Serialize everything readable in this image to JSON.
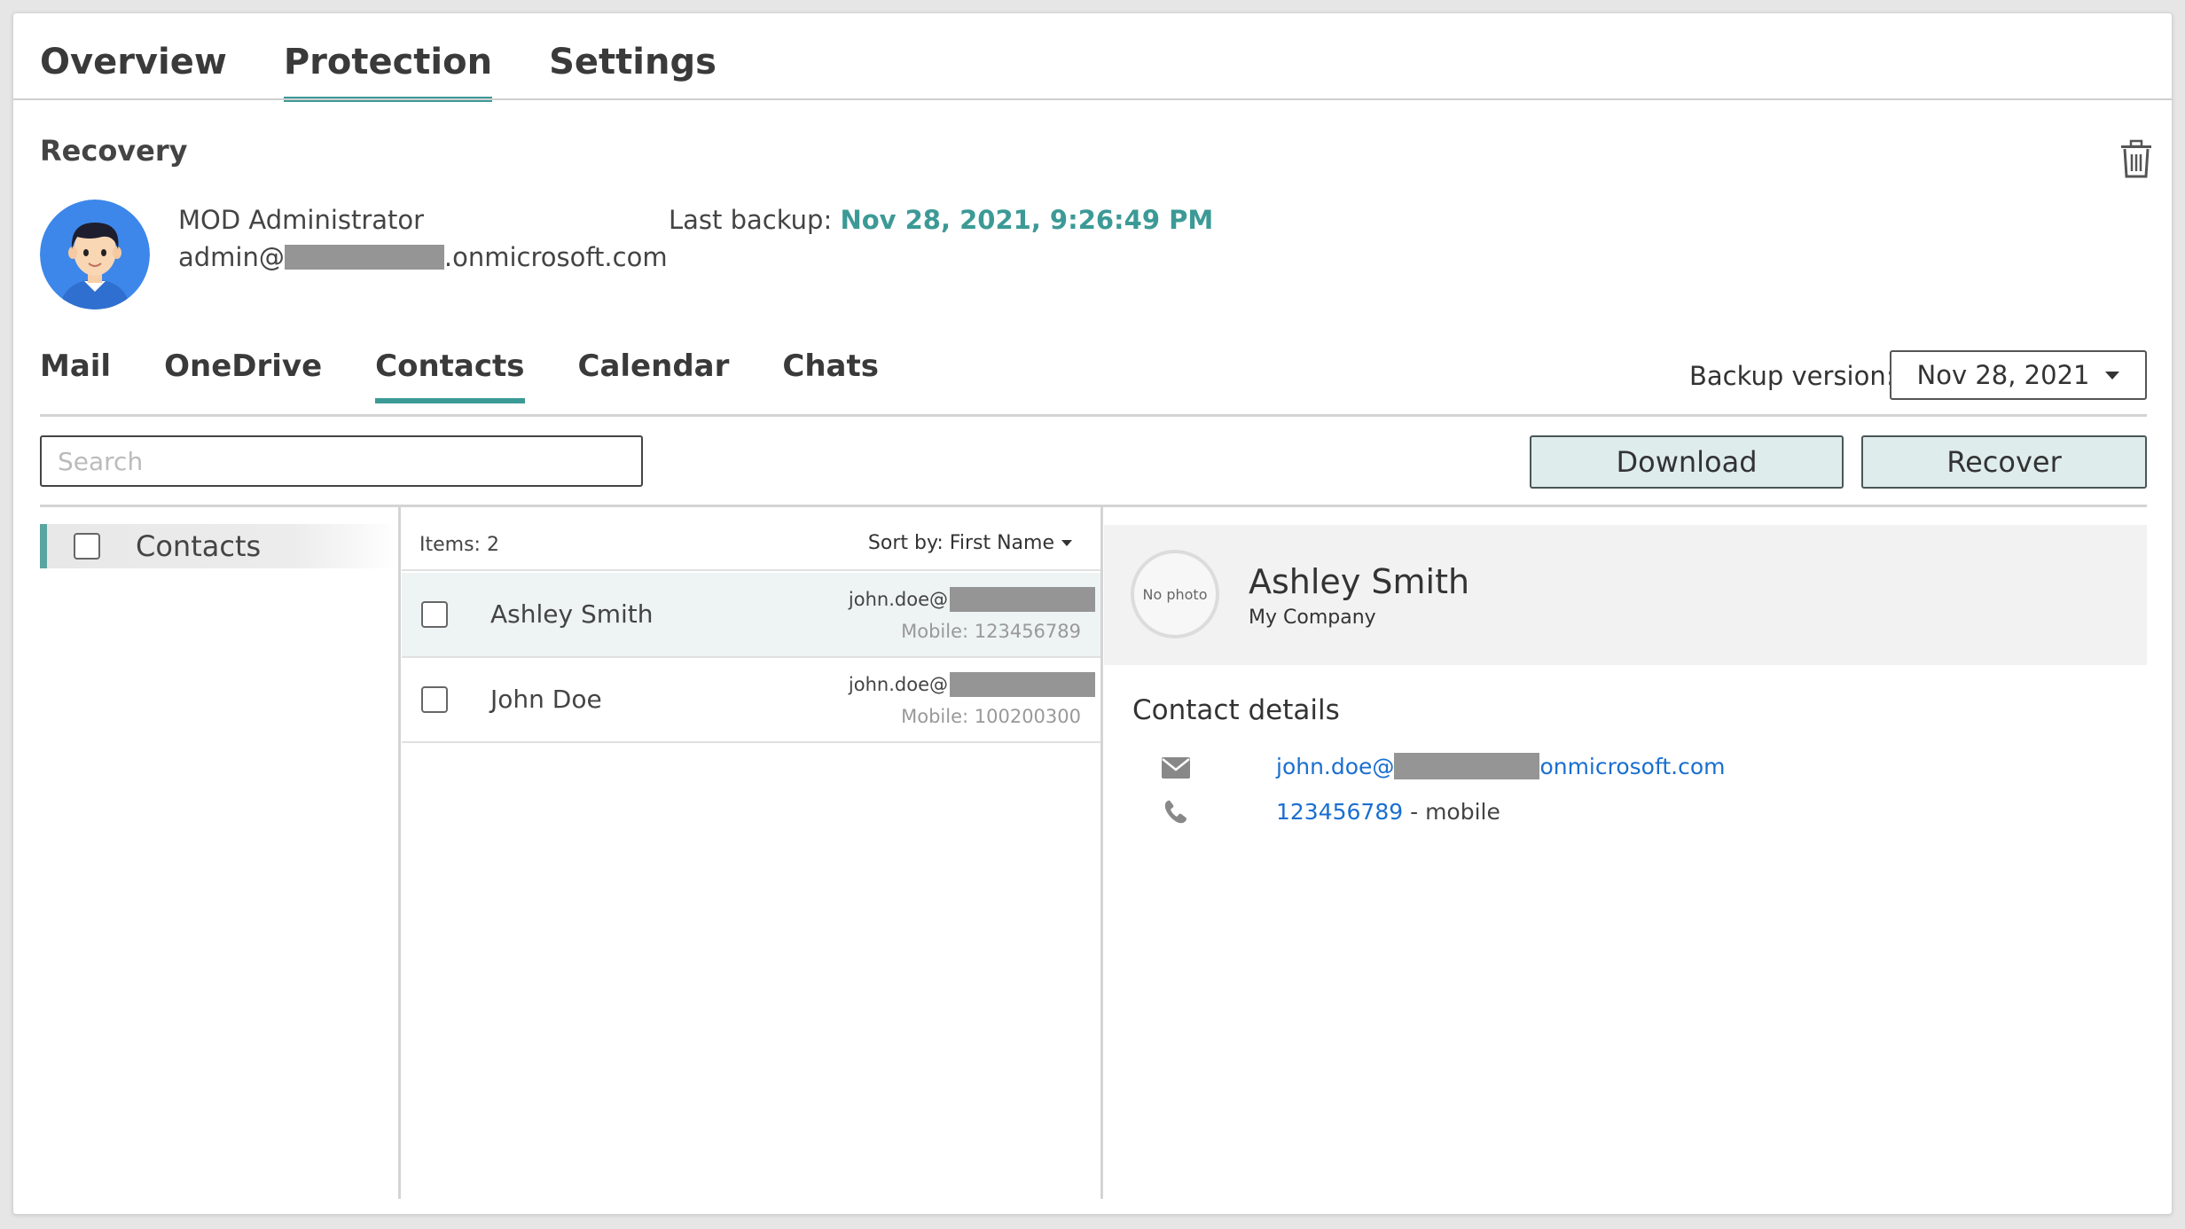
{
  "tabs": [
    "Overview",
    "Protection",
    "Settings"
  ],
  "section_title": "Recovery",
  "user": {
    "name": "MOD Administrator",
    "email_prefix": "admin@",
    "email_suffix": ".onmicrosoft.com"
  },
  "last_backup": {
    "label": "Last backup:",
    "value": "Nov 28, 2021, 9:26:49 PM"
  },
  "sub_tabs": [
    "Mail",
    "OneDrive",
    "Contacts",
    "Calendar",
    "Chats"
  ],
  "backup_version": {
    "label": "Backup version:",
    "value": "Nov 28, 2021"
  },
  "search": {
    "placeholder": "Search"
  },
  "buttons": {
    "download": "Download",
    "recover": "Recover"
  },
  "folder": {
    "label": "Contacts"
  },
  "list": {
    "items_count": "Items: 2",
    "sort_label": "Sort by: First Name",
    "rows": [
      {
        "name": "Ashley Smith",
        "email_prefix": "john.doe@",
        "mobile": "Mobile: 123456789"
      },
      {
        "name": "John Doe",
        "email_prefix": "john.doe@",
        "mobile": "Mobile: 100200300"
      }
    ]
  },
  "detail": {
    "no_photo": "No photo",
    "name": "Ashley Smith",
    "company": "My Company",
    "section_title": "Contact details",
    "email_prefix": "john.doe@",
    "email_suffix": "onmicrosoft.com",
    "phone": "123456789",
    "phone_suffix": " - mobile"
  },
  "icons": {
    "trash": "trash-icon",
    "email": "envelope-icon",
    "phone": "phone-icon",
    "dropdown": "caret-down-icon",
    "avatar": "user-avatar"
  },
  "colors": {
    "accent": "#3c9a96",
    "link": "#1a6fd0",
    "button_bg": "#deeceb",
    "redaction": "#959595"
  }
}
